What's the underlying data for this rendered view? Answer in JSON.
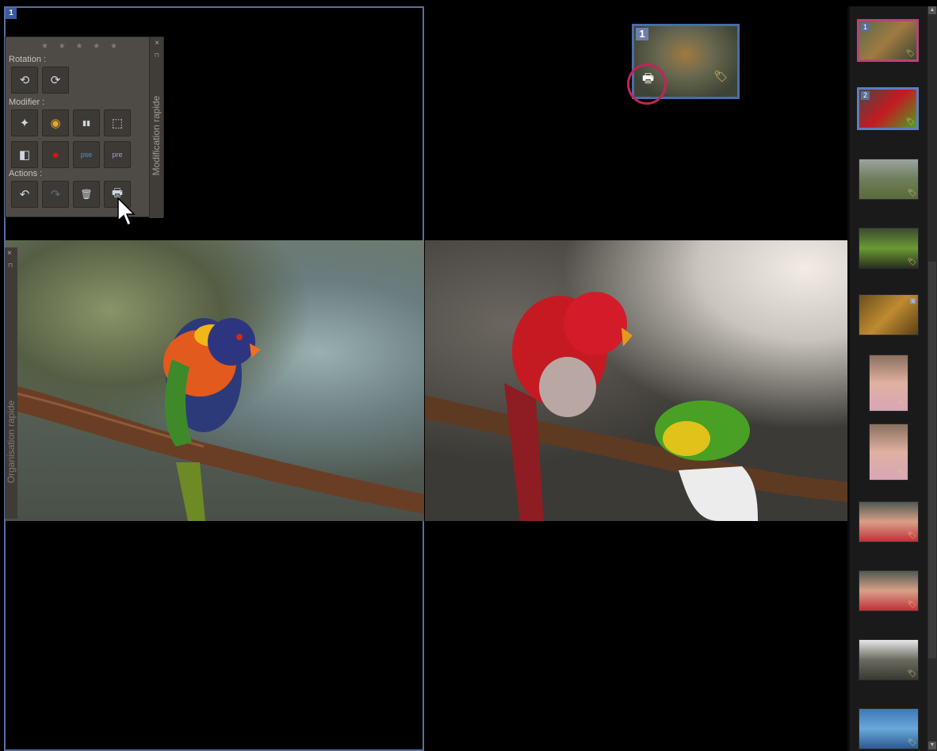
{
  "panes": {
    "left_number": "1"
  },
  "quick_edit": {
    "rating_stars": "★ ★ ★ ★ ★",
    "rotation_label": "Rotation :",
    "modify_label": "Modifier :",
    "actions_label": "Actions :",
    "panel_title": "Modification rapide",
    "close": "×",
    "pin": "⊓",
    "buttons": {
      "rotate_left": "⟲",
      "rotate_right": "⟳",
      "smart_fix": "✦",
      "color": "◉",
      "levels": "▮▮",
      "crop": "⬚",
      "straighten": "◧",
      "red_eye": "●",
      "edit_pse": "pse",
      "edit_pre": "pre",
      "undo": "↶",
      "redo": "↷",
      "delete": "🗑",
      "print": "🖶"
    }
  },
  "organize": {
    "panel_title": "Organisation rapide",
    "close": "×",
    "pin": "⊓"
  },
  "navigator": {
    "number": "1",
    "printer_icon": "🖶",
    "tag_icon": "🏷"
  },
  "filmstrip": {
    "items": [
      {
        "number": "1",
        "tag": "🏷"
      },
      {
        "number": "2",
        "tag": "🏷"
      },
      {
        "number": "",
        "tag": "🏷"
      },
      {
        "number": "",
        "tag": "🏷"
      },
      {
        "number": "",
        "tag": "▣"
      },
      {
        "number": "",
        "tag": "🏷"
      },
      {
        "number": "",
        "tag": "🏷"
      },
      {
        "number": "",
        "tag": "🏷"
      },
      {
        "number": "",
        "tag": "🏷"
      },
      {
        "number": "",
        "tag": "🏷"
      },
      {
        "number": "",
        "tag": "🏷"
      }
    ]
  },
  "scrollbar": {
    "up": "▲",
    "down": "▼"
  },
  "colors": {
    "pane_border": "#5a6e9e",
    "highlight": "#c0245a",
    "panel_bg": "#4e4a45",
    "film_sel_pink": "#b44576",
    "film_sel_blue": "#5f7dbc"
  }
}
